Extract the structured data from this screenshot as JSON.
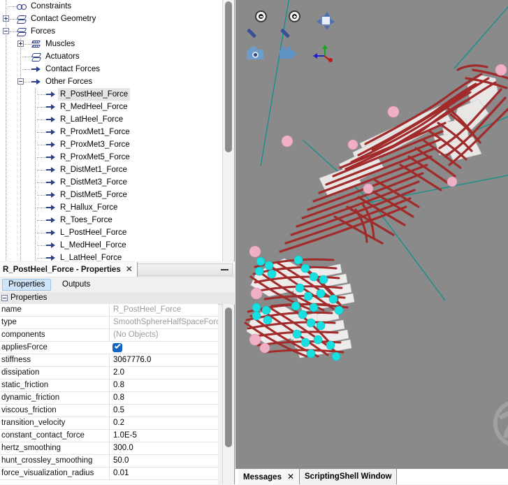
{
  "navigator": {
    "items": [
      {
        "label": "Constraints",
        "depth": 1,
        "icon": "constraints-icon",
        "expander": "none",
        "selected": false
      },
      {
        "label": "Contact Geometry",
        "depth": 1,
        "icon": "contact-geometry-icon",
        "expander": "plus",
        "selected": false
      },
      {
        "label": "Forces",
        "depth": 1,
        "icon": "forces-icon",
        "expander": "minus",
        "selected": false
      },
      {
        "label": "Muscles",
        "depth": 2,
        "icon": "muscles-icon",
        "expander": "plus",
        "selected": false
      },
      {
        "label": "Actuators",
        "depth": 2,
        "icon": "actuators-icon",
        "expander": "none",
        "selected": false
      },
      {
        "label": "Contact Forces",
        "depth": 2,
        "icon": "force-arrow-icon",
        "expander": "none",
        "selected": false
      },
      {
        "label": "Other Forces",
        "depth": 2,
        "icon": "force-arrow-icon",
        "expander": "minus",
        "selected": false
      },
      {
        "label": "R_PostHeel_Force",
        "depth": 3,
        "icon": "force-arrow-icon",
        "expander": "none",
        "selected": true
      },
      {
        "label": "R_MedHeel_Force",
        "depth": 3,
        "icon": "force-arrow-icon",
        "expander": "none",
        "selected": false
      },
      {
        "label": "R_LatHeel_Force",
        "depth": 3,
        "icon": "force-arrow-icon",
        "expander": "none",
        "selected": false
      },
      {
        "label": "R_ProxMet1_Force",
        "depth": 3,
        "icon": "force-arrow-icon",
        "expander": "none",
        "selected": false
      },
      {
        "label": "R_ProxMet3_Force",
        "depth": 3,
        "icon": "force-arrow-icon",
        "expander": "none",
        "selected": false
      },
      {
        "label": "R_ProxMet5_Force",
        "depth": 3,
        "icon": "force-arrow-icon",
        "expander": "none",
        "selected": false
      },
      {
        "label": "R_DistMet1_Force",
        "depth": 3,
        "icon": "force-arrow-icon",
        "expander": "none",
        "selected": false
      },
      {
        "label": "R_DistMet3_Force",
        "depth": 3,
        "icon": "force-arrow-icon",
        "expander": "none",
        "selected": false
      },
      {
        "label": "R_DistMet5_Force",
        "depth": 3,
        "icon": "force-arrow-icon",
        "expander": "none",
        "selected": false
      },
      {
        "label": "R_Hallux_Force",
        "depth": 3,
        "icon": "force-arrow-icon",
        "expander": "none",
        "selected": false
      },
      {
        "label": "R_Toes_Force",
        "depth": 3,
        "icon": "force-arrow-icon",
        "expander": "none",
        "selected": false
      },
      {
        "label": "L_PostHeel_Force",
        "depth": 3,
        "icon": "force-arrow-icon",
        "expander": "none",
        "selected": false
      },
      {
        "label": "L_MedHeel_Force",
        "depth": 3,
        "icon": "force-arrow-icon",
        "expander": "none",
        "selected": false
      },
      {
        "label": "L_LatHeel_Force",
        "depth": 3,
        "icon": "force-arrow-icon",
        "expander": "none",
        "selected": false
      }
    ]
  },
  "properties_window": {
    "title": "R_PostHeel_Force - Properties",
    "close_glyph": "✕",
    "minimize_name": "minimize-button",
    "tabs": [
      {
        "label": "Properties",
        "active": true
      },
      {
        "label": "Outputs",
        "active": false
      }
    ],
    "group_label": "Properties",
    "rows": [
      {
        "key": "name",
        "value": "R_PostHeel_Force",
        "readonly": true,
        "type": "text"
      },
      {
        "key": "type",
        "value": "SmoothSphereHalfSpaceForce",
        "readonly": true,
        "type": "text"
      },
      {
        "key": "components",
        "value": "(No Objects)",
        "readonly": true,
        "type": "text"
      },
      {
        "key": "appliesForce",
        "value": "",
        "readonly": false,
        "type": "checkbox",
        "checked": true
      },
      {
        "key": "stiffness",
        "value": "3067776.0",
        "readonly": false,
        "type": "text"
      },
      {
        "key": "dissipation",
        "value": "2.0",
        "readonly": false,
        "type": "text"
      },
      {
        "key": "static_friction",
        "value": "0.8",
        "readonly": false,
        "type": "text"
      },
      {
        "key": "dynamic_friction",
        "value": "0.8",
        "readonly": false,
        "type": "text"
      },
      {
        "key": "viscous_friction",
        "value": "0.5",
        "readonly": false,
        "type": "text"
      },
      {
        "key": "transition_velocity",
        "value": "0.2",
        "readonly": false,
        "type": "text"
      },
      {
        "key": "constant_contact_force",
        "value": "1.0E-5",
        "readonly": false,
        "type": "text"
      },
      {
        "key": "hertz_smoothing",
        "value": "300.0",
        "readonly": false,
        "type": "text"
      },
      {
        "key": "hunt_crossley_smoothing",
        "value": "50.0",
        "readonly": false,
        "type": "text"
      },
      {
        "key": "force_visualization_radius",
        "value": "0.01",
        "readonly": false,
        "type": "text"
      }
    ]
  },
  "viewport": {
    "background_color": "#8a8a8a",
    "toolbar": [
      {
        "name": "zoom-out-button",
        "icon": "magnifier-minus-icon"
      },
      {
        "name": "zoom-in-button",
        "icon": "magnifier-plus-icon"
      },
      {
        "name": "fit-to-window-button",
        "icon": "fit-box-icon"
      },
      {
        "name": "snapshot-button",
        "icon": "camera-icon"
      },
      {
        "name": "record-movie-button",
        "icon": "movie-camera-icon"
      },
      {
        "name": "toggle-axes-button",
        "icon": "xyz-axes-icon"
      }
    ],
    "watermark": "opensim-logo",
    "model_colors": {
      "muscle": "#a02a2a",
      "bone": "#eceaea",
      "marker_pink": "#efadc4",
      "marker_cyan": "#19e0e0",
      "guide_line": "#15908c"
    }
  },
  "output_dock": {
    "tabs": [
      {
        "label": "Messages",
        "active": true,
        "closable": true,
        "close_glyph": "✕"
      },
      {
        "label": "ScriptingShell Window",
        "active": false,
        "closable": false,
        "close_glyph": ""
      }
    ]
  }
}
